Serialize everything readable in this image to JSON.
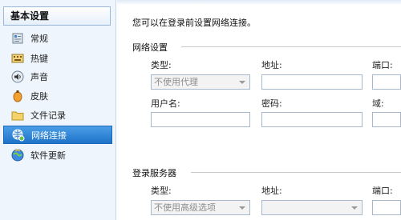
{
  "sidebar": {
    "header": "基本设置",
    "items": [
      {
        "label": "常规",
        "icon": "settings-panel-icon"
      },
      {
        "label": "热键",
        "icon": "keyboard-icon"
      },
      {
        "label": "声音",
        "icon": "speaker-icon"
      },
      {
        "label": "皮肤",
        "icon": "skin-icon"
      },
      {
        "label": "文件记录",
        "icon": "folder-icon"
      },
      {
        "label": "网络连接",
        "icon": "network-icon",
        "active": true
      },
      {
        "label": "软件更新",
        "icon": "update-globe-icon"
      }
    ]
  },
  "main": {
    "intro": "您可以在登录前设置网络连接。",
    "network": {
      "title": "网络设置",
      "type_label": "类型:",
      "type_value": "不使用代理",
      "address_label": "地址:",
      "port_label": "端口:",
      "username_label": "用户名:",
      "password_label": "密码:",
      "domain_label": "域:"
    },
    "login_server": {
      "title": "登录服务器",
      "type_label": "类型:",
      "type_value": "不使用高级选项",
      "address_label": "地址:",
      "port_label": "端口:"
    }
  },
  "colors": {
    "active_nav": "#2a82d6",
    "sidebar_bg": "#eef5fc"
  }
}
